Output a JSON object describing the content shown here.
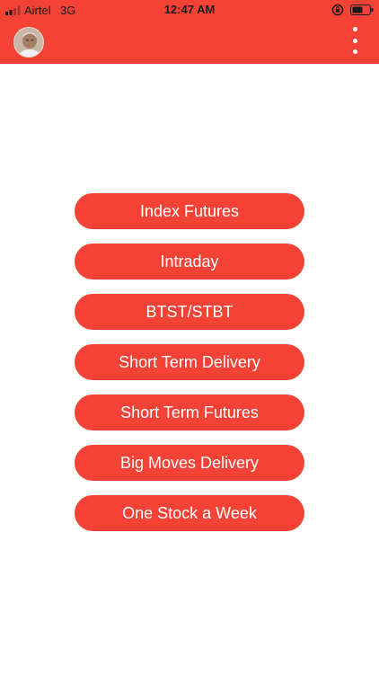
{
  "status_bar": {
    "carrier": "Airtel",
    "network": "3G",
    "time": "12:47 AM"
  },
  "header": {
    "avatar_icon": "user-photo-avatar",
    "menu_icon": "more-vertical-icon",
    "background_color": "#f44336"
  },
  "menu": {
    "items": [
      {
        "label": "Index Futures"
      },
      {
        "label": "Intraday"
      },
      {
        "label": "BTST/STBT"
      },
      {
        "label": "Short Term Delivery"
      },
      {
        "label": "Short Term Futures"
      },
      {
        "label": "Big Moves Delivery"
      },
      {
        "label": "One Stock a Week"
      }
    ]
  },
  "colors": {
    "accent": "#f44336",
    "button_text": "#ffffff",
    "background": "#ffffff"
  }
}
